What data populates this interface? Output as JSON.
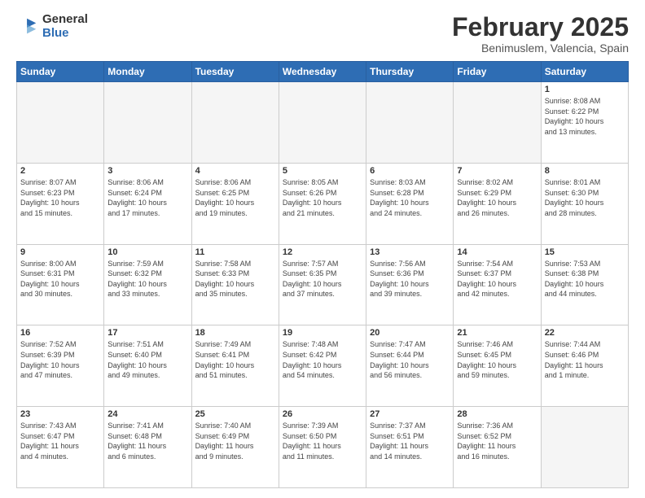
{
  "logo": {
    "general": "General",
    "blue": "Blue"
  },
  "title": "February 2025",
  "subtitle": "Benimuslem, Valencia, Spain",
  "days_of_week": [
    "Sunday",
    "Monday",
    "Tuesday",
    "Wednesday",
    "Thursday",
    "Friday",
    "Saturday"
  ],
  "weeks": [
    [
      {
        "day": "",
        "info": ""
      },
      {
        "day": "",
        "info": ""
      },
      {
        "day": "",
        "info": ""
      },
      {
        "day": "",
        "info": ""
      },
      {
        "day": "",
        "info": ""
      },
      {
        "day": "",
        "info": ""
      },
      {
        "day": "1",
        "info": "Sunrise: 8:08 AM\nSunset: 6:22 PM\nDaylight: 10 hours\nand 13 minutes."
      }
    ],
    [
      {
        "day": "2",
        "info": "Sunrise: 8:07 AM\nSunset: 6:23 PM\nDaylight: 10 hours\nand 15 minutes."
      },
      {
        "day": "3",
        "info": "Sunrise: 8:06 AM\nSunset: 6:24 PM\nDaylight: 10 hours\nand 17 minutes."
      },
      {
        "day": "4",
        "info": "Sunrise: 8:06 AM\nSunset: 6:25 PM\nDaylight: 10 hours\nand 19 minutes."
      },
      {
        "day": "5",
        "info": "Sunrise: 8:05 AM\nSunset: 6:26 PM\nDaylight: 10 hours\nand 21 minutes."
      },
      {
        "day": "6",
        "info": "Sunrise: 8:03 AM\nSunset: 6:28 PM\nDaylight: 10 hours\nand 24 minutes."
      },
      {
        "day": "7",
        "info": "Sunrise: 8:02 AM\nSunset: 6:29 PM\nDaylight: 10 hours\nand 26 minutes."
      },
      {
        "day": "8",
        "info": "Sunrise: 8:01 AM\nSunset: 6:30 PM\nDaylight: 10 hours\nand 28 minutes."
      }
    ],
    [
      {
        "day": "9",
        "info": "Sunrise: 8:00 AM\nSunset: 6:31 PM\nDaylight: 10 hours\nand 30 minutes."
      },
      {
        "day": "10",
        "info": "Sunrise: 7:59 AM\nSunset: 6:32 PM\nDaylight: 10 hours\nand 33 minutes."
      },
      {
        "day": "11",
        "info": "Sunrise: 7:58 AM\nSunset: 6:33 PM\nDaylight: 10 hours\nand 35 minutes."
      },
      {
        "day": "12",
        "info": "Sunrise: 7:57 AM\nSunset: 6:35 PM\nDaylight: 10 hours\nand 37 minutes."
      },
      {
        "day": "13",
        "info": "Sunrise: 7:56 AM\nSunset: 6:36 PM\nDaylight: 10 hours\nand 39 minutes."
      },
      {
        "day": "14",
        "info": "Sunrise: 7:54 AM\nSunset: 6:37 PM\nDaylight: 10 hours\nand 42 minutes."
      },
      {
        "day": "15",
        "info": "Sunrise: 7:53 AM\nSunset: 6:38 PM\nDaylight: 10 hours\nand 44 minutes."
      }
    ],
    [
      {
        "day": "16",
        "info": "Sunrise: 7:52 AM\nSunset: 6:39 PM\nDaylight: 10 hours\nand 47 minutes."
      },
      {
        "day": "17",
        "info": "Sunrise: 7:51 AM\nSunset: 6:40 PM\nDaylight: 10 hours\nand 49 minutes."
      },
      {
        "day": "18",
        "info": "Sunrise: 7:49 AM\nSunset: 6:41 PM\nDaylight: 10 hours\nand 51 minutes."
      },
      {
        "day": "19",
        "info": "Sunrise: 7:48 AM\nSunset: 6:42 PM\nDaylight: 10 hours\nand 54 minutes."
      },
      {
        "day": "20",
        "info": "Sunrise: 7:47 AM\nSunset: 6:44 PM\nDaylight: 10 hours\nand 56 minutes."
      },
      {
        "day": "21",
        "info": "Sunrise: 7:46 AM\nSunset: 6:45 PM\nDaylight: 10 hours\nand 59 minutes."
      },
      {
        "day": "22",
        "info": "Sunrise: 7:44 AM\nSunset: 6:46 PM\nDaylight: 11 hours\nand 1 minute."
      }
    ],
    [
      {
        "day": "23",
        "info": "Sunrise: 7:43 AM\nSunset: 6:47 PM\nDaylight: 11 hours\nand 4 minutes."
      },
      {
        "day": "24",
        "info": "Sunrise: 7:41 AM\nSunset: 6:48 PM\nDaylight: 11 hours\nand 6 minutes."
      },
      {
        "day": "25",
        "info": "Sunrise: 7:40 AM\nSunset: 6:49 PM\nDaylight: 11 hours\nand 9 minutes."
      },
      {
        "day": "26",
        "info": "Sunrise: 7:39 AM\nSunset: 6:50 PM\nDaylight: 11 hours\nand 11 minutes."
      },
      {
        "day": "27",
        "info": "Sunrise: 7:37 AM\nSunset: 6:51 PM\nDaylight: 11 hours\nand 14 minutes."
      },
      {
        "day": "28",
        "info": "Sunrise: 7:36 AM\nSunset: 6:52 PM\nDaylight: 11 hours\nand 16 minutes."
      },
      {
        "day": "",
        "info": ""
      }
    ]
  ]
}
